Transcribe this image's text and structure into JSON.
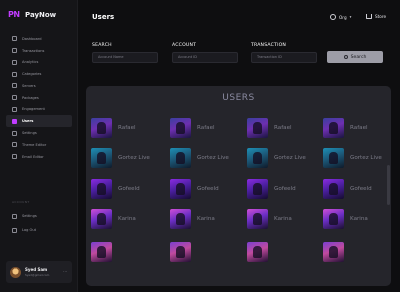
{
  "app": {
    "name": "PayNow",
    "logo_text": "PN"
  },
  "sidebar": {
    "items": [
      {
        "label": "Dashboard",
        "icon": "dashboard-icon",
        "active": false
      },
      {
        "label": "Transactions",
        "icon": "transactions-icon",
        "active": false
      },
      {
        "label": "Analytics",
        "icon": "analytics-icon",
        "active": false
      },
      {
        "label": "Categories",
        "icon": "categories-icon",
        "active": false
      },
      {
        "label": "Servers",
        "icon": "servers-icon",
        "active": false
      },
      {
        "label": "Packages",
        "icon": "packages-icon",
        "active": false
      },
      {
        "label": "Engagement",
        "icon": "engagement-icon",
        "active": false
      },
      {
        "label": "Users",
        "icon": "users-icon",
        "active": true
      },
      {
        "label": "Settings",
        "icon": "settings-icon",
        "active": false
      },
      {
        "label": "Theme Editor",
        "icon": "theme-editor-icon",
        "active": false
      },
      {
        "label": "Email Editor",
        "icon": "email-editor-icon",
        "active": false
      }
    ],
    "section_label": "ACCOUNT",
    "secondary_items": [
      {
        "label": "Settings",
        "icon": "gear-icon"
      },
      {
        "label": "Log Out",
        "icon": "logout-icon"
      }
    ],
    "profile": {
      "name": "Syed Sam",
      "email": "Syed@gmail.com",
      "menu": "···"
    }
  },
  "header": {
    "title": "Users",
    "org_label": "Org",
    "org_chevron": "▾",
    "store_label": "Store"
  },
  "filters": {
    "search": {
      "label": "SEARCH",
      "placeholder": "Account Name"
    },
    "account": {
      "label": "ACCOUNT",
      "placeholder": "Account ID"
    },
    "transaction": {
      "label": "TRANSACTION",
      "placeholder": "Transaction ID"
    },
    "button_label": "Search"
  },
  "users": {
    "title": "USERS",
    "rows": [
      [
        "Rafael",
        "Rafael",
        "Rafael",
        "Rafael"
      ],
      [
        "Gortez Live",
        "Gortez Live",
        "Gortez Live",
        "Gortez Live"
      ],
      [
        "Gofeeld",
        "Gofeeld",
        "Gofeeld",
        "Gofeeld"
      ],
      [
        "Karina",
        "Karina",
        "Karina",
        "Karina"
      ],
      [
        "",
        "",
        "",
        ""
      ]
    ]
  },
  "colors": {
    "accent": "#c13cff",
    "background": "#0e0e10",
    "panel": "#25252b",
    "button": "#9d9da7"
  }
}
